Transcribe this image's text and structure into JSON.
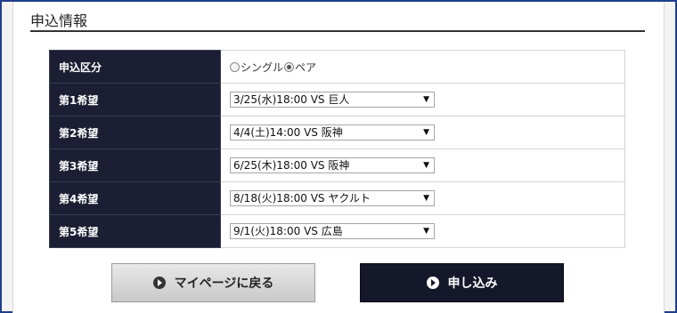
{
  "section": {
    "title": "申込情報"
  },
  "form": {
    "type_row": {
      "label": "申込区分",
      "options": [
        {
          "label": "シングル",
          "checked": false
        },
        {
          "label": "ペア",
          "checked": true
        }
      ]
    },
    "choices": [
      {
        "label": "第1希望",
        "value": "3/25(水)18:00 VS 巨人"
      },
      {
        "label": "第2希望",
        "value": "4/4(土)14:00 VS 阪神"
      },
      {
        "label": "第3希望",
        "value": "6/25(木)18:00 VS 阪神"
      },
      {
        "label": "第4希望",
        "value": "8/18(火)18:00 VS ヤクルト"
      },
      {
        "label": "第5希望",
        "value": "9/1(火)18:00 VS 広島"
      }
    ]
  },
  "buttons": {
    "back_label": "マイページに戻る",
    "submit_label": "申し込み"
  },
  "colors": {
    "label_bg": "#1c1f33",
    "submit_bg": "#15172a",
    "frame_border": "#1e3f8a"
  }
}
